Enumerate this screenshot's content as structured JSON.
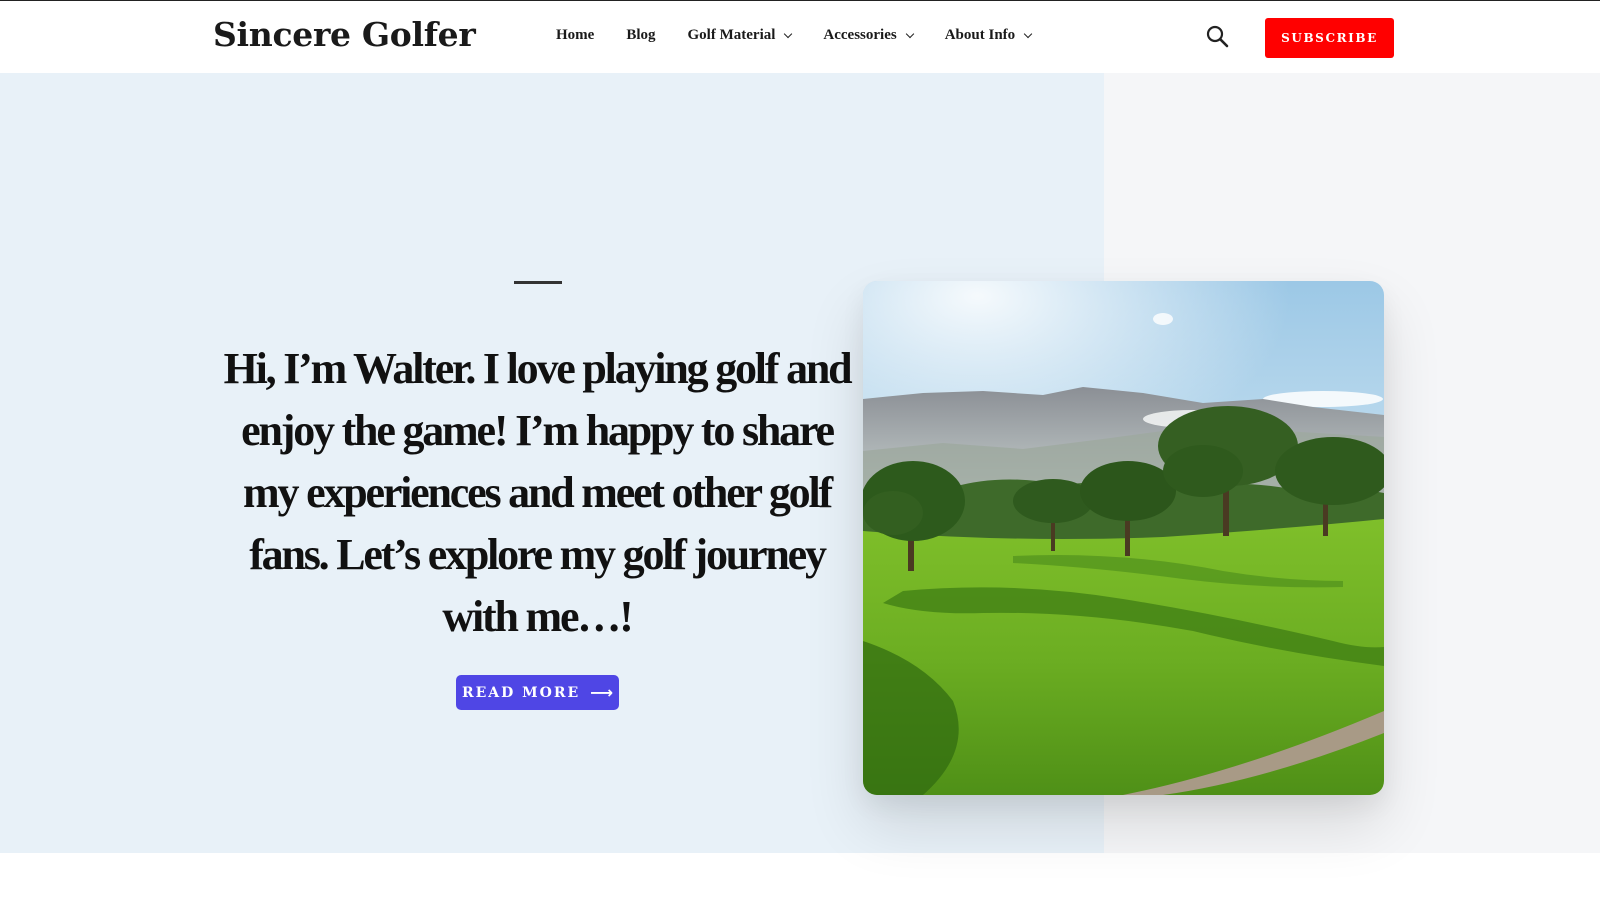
{
  "header": {
    "logo": "Sincere Golfer",
    "nav": [
      {
        "label": "Home",
        "has_dropdown": false
      },
      {
        "label": "Blog",
        "has_dropdown": false
      },
      {
        "label": "Golf Material",
        "has_dropdown": true
      },
      {
        "label": "Accessories",
        "has_dropdown": true
      },
      {
        "label": "About Info",
        "has_dropdown": true
      }
    ],
    "search_icon": "search-icon",
    "subscribe_label": "SUBSCRIBE"
  },
  "hero": {
    "text": "Hi, I’m Walter. I love playing golf and enjoy the game! I’m happy to share my experiences and meet other golf fans. Let’s explore my golf journey with me…!",
    "button_label": "READ MORE",
    "button_icon": "arrow-right-icon",
    "image_subject": "golf-course-landscape"
  },
  "colors": {
    "brand_red": "#ff0000",
    "accent_indigo": "#4f46e5",
    "hero_bg": "#e8f1f8",
    "side_bg": "#f5f6f8"
  }
}
